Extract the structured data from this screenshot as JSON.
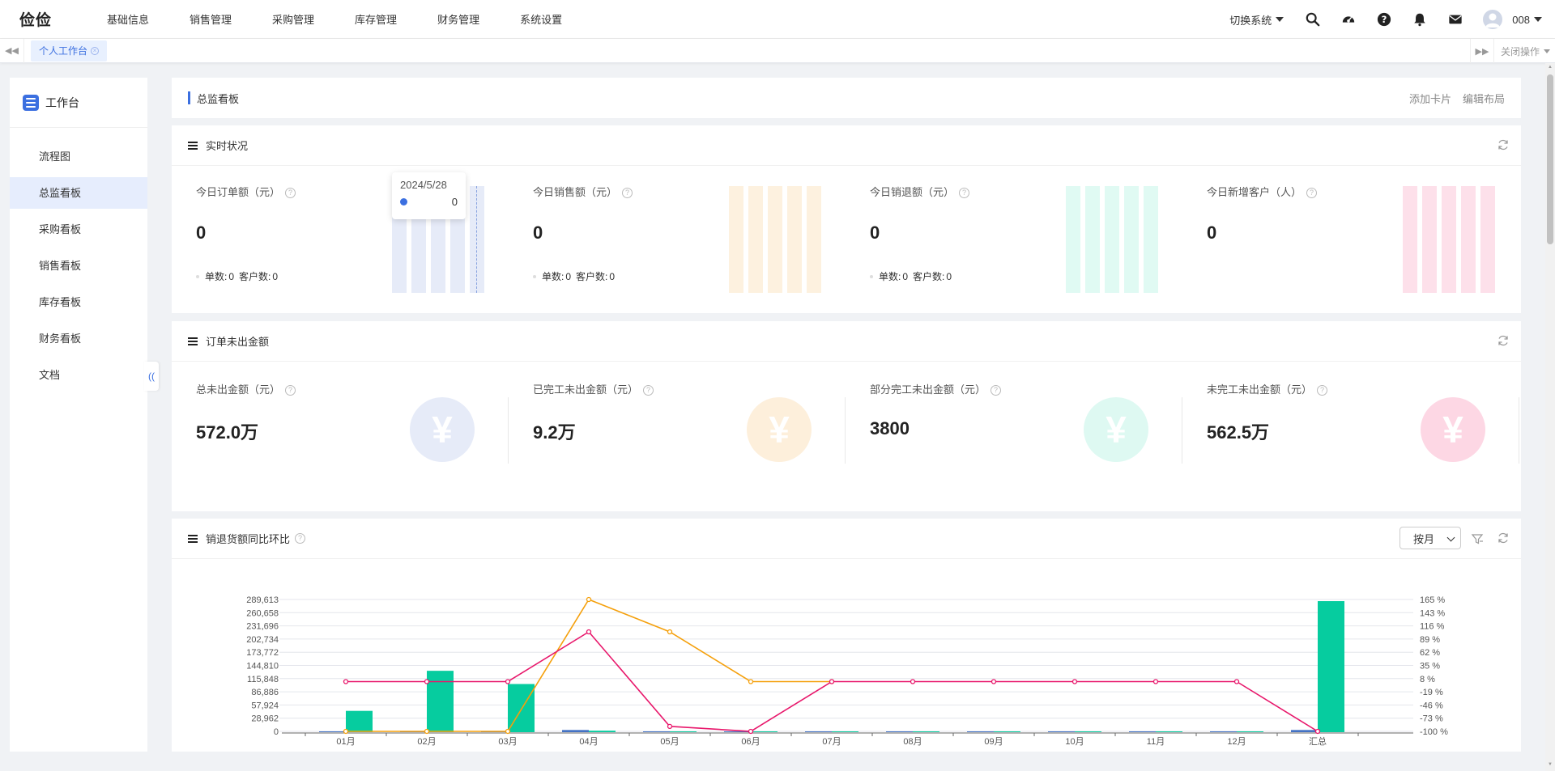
{
  "app": {
    "logo": "俭俭"
  },
  "nav": [
    "基础信息",
    "销售管理",
    "采购管理",
    "库存管理",
    "财务管理",
    "系统设置"
  ],
  "topright": {
    "switch_system": "切换系统",
    "username": "008"
  },
  "tabs": {
    "active": "个人工作台",
    "close_ops": "关闭操作"
  },
  "sidebar": {
    "title": "工作台",
    "items": [
      "流程图",
      "总监看板",
      "采购看板",
      "销售看板",
      "库存看板",
      "财务看板",
      "文档"
    ],
    "active_index": 1
  },
  "board": {
    "title": "总监看板",
    "add_card": "添加卡片",
    "edit_layout": "编辑布局"
  },
  "realtime": {
    "title": "实时状况",
    "cells": [
      {
        "label": "今日订单额（元）",
        "value": "0",
        "count_label": "单数:",
        "count": "0",
        "cust_label": "客户数:",
        "cust": "0",
        "color": "#e6ebf8"
      },
      {
        "label": "今日销售额（元）",
        "value": "0",
        "count_label": "单数:",
        "count": "0",
        "cust_label": "客户数:",
        "cust": "0",
        "color": "#fdf1df"
      },
      {
        "label": "今日销退额（元）",
        "value": "0",
        "count_label": "单数:",
        "count": "0",
        "cust_label": "客户数:",
        "cust": "0",
        "color": "#e0faf3"
      },
      {
        "label": "今日新增客户（人）",
        "value": "0",
        "color": "#fde0ea"
      }
    ],
    "tooltip": {
      "date": "2024/5/28",
      "value": "0"
    }
  },
  "unshipped": {
    "title": "订单未出金额",
    "cells": [
      {
        "label": "总未出金额（元）",
        "value": "572.0万",
        "color": "#e6ebf8"
      },
      {
        "label": "已完工未出金额（元）",
        "value": "9.2万",
        "color": "#fdefdb"
      },
      {
        "label": "部分完工未出金额（元）",
        "value": "3800",
        "color": "#def9f2"
      },
      {
        "label": "未完工未出金额（元）",
        "value": "562.5万",
        "color": "#fdd7e4"
      }
    ]
  },
  "chart_section": {
    "title": "销退货额同比环比",
    "period_select": "按月"
  },
  "chart_data": {
    "type": "bar",
    "categories": [
      "01月",
      "02月",
      "03月",
      "04月",
      "05月",
      "06月",
      "07月",
      "08月",
      "09月",
      "10月",
      "11月",
      "12月",
      "汇总"
    ],
    "y_left_ticks": [
      "0",
      "28,962",
      "57,924",
      "86,886",
      "115,848",
      "144,810",
      "173,772",
      "202,734",
      "231,696",
      "260,658",
      "289,613"
    ],
    "y_right_ticks": [
      "-100 %",
      "-73 %",
      "-46 %",
      "-19 %",
      "8 %",
      "35 %",
      "62 %",
      "89 %",
      "116 %",
      "143 %",
      "165 %"
    ],
    "ylim": [
      0,
      289613
    ],
    "y2lim": [
      -100,
      165
    ],
    "series": [
      {
        "kind": "bar",
        "color": "#4472c4",
        "values": [
          0,
          0,
          0,
          3000,
          0,
          0,
          0,
          0,
          0,
          0,
          0,
          0,
          3000
        ]
      },
      {
        "kind": "bar",
        "color": "#06cc9f",
        "values": [
          45000,
          133000,
          104000,
          1500,
          0,
          0,
          0,
          0,
          0,
          0,
          0,
          0,
          286000
        ]
      },
      {
        "kind": "line",
        "color": "#f5a00c",
        "values": [
          -100,
          -100,
          -100,
          165,
          100,
          0,
          0,
          null,
          null,
          null,
          null,
          null,
          null
        ]
      },
      {
        "kind": "line",
        "color": "#e8176b",
        "values": [
          0,
          0,
          0,
          100,
          -90,
          -100,
          0,
          0,
          0,
          0,
          0,
          0,
          -100
        ]
      }
    ]
  }
}
